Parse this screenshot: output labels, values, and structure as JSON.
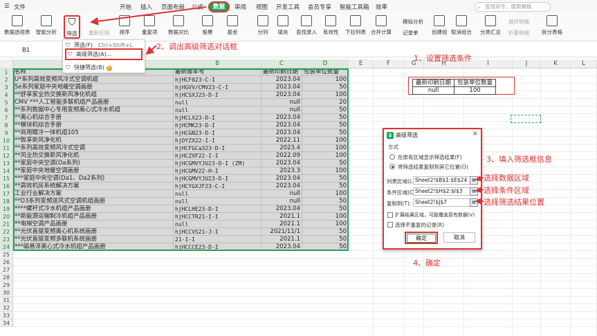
{
  "menubar": {
    "file": "文件",
    "start": "开始",
    "insert": "插入",
    "page_layout": "页面布局",
    "formulas": "公式",
    "data": "数据",
    "review": "审阅",
    "view": "视图",
    "developer": "开发工具",
    "member": "会员专享",
    "smart_toolbox": "智能工具箱",
    "efficiency": "效率",
    "search_placeholder": "查找命令、搜索模板"
  },
  "ribbon": {
    "pivot_table": "数据透视表",
    "smart_analysis": "智能分析",
    "filter": "筛选",
    "reapply": "重新应用",
    "sort": "排序",
    "duplicates": "重复项",
    "compare": "数据对比",
    "stocks": "股票",
    "fund": "基金",
    "split_columns": "分列",
    "fill": "填充",
    "find_entry": "查找录入",
    "validity": "有效性",
    "dropdown_list": "下拉列表",
    "merge_calc": "合并计算",
    "simulation": "模拟分析",
    "record_sheet": "记录单",
    "create_group": "创建组",
    "ungroup": "取消组合",
    "subtotal": "分类汇总",
    "expand_detail": "展开明细",
    "collapse_detail": "折叠明细",
    "split_sheet": "拆分表格"
  },
  "dropdown": {
    "filter": "筛选(F)",
    "filter_shortcut": "Ctrl+Shift+L",
    "advanced_filter": "高级筛选(A)...",
    "quick_filter": "快捷筛选(B)"
  },
  "formula_bar": {
    "cell_ref": "B1",
    "fx": "fx"
  },
  "columns": [
    "A",
    "B",
    "C",
    "D",
    "E",
    "F",
    "G",
    "H",
    "I",
    "J",
    "K",
    "L"
  ],
  "rows": [
    "1",
    "2",
    "3",
    "4",
    "5",
    "6",
    "7",
    "8",
    "9",
    "10",
    "11",
    "12",
    "13",
    "14",
    "15",
    "16",
    "17",
    "18",
    "19",
    "20",
    "21",
    "22",
    "23",
    "24",
    "25",
    "26",
    "27",
    "28",
    "29",
    "30",
    "31",
    "32",
    "33",
    "34"
  ],
  "table": {
    "headers": [
      "名称",
      "最新版本号",
      "最新印刷日期",
      "包装单位数量"
    ],
    "rows": [
      [
        "U*系列高效变频风冷式空调机组",
        "hjHCF023-C-I",
        "2023.04",
        "100"
      ],
      [
        "5e系列家庭中央地暖空调画册",
        "hjHGVV/CMV23-C-I",
        "2023.04",
        "50"
      ],
      [
        "**舒享家全热交换新风净化机组",
        "hjHCSXJ23-D-I",
        "2023.04",
        "100"
      ],
      [
        "CMV ***人工智能多联机组产品画册",
        "null",
        "null",
        "20"
      ],
      [
        "**系列数据中心专用变频离心式冷水机组",
        "null",
        "null",
        "50"
      ],
      [
        "**离心机综合手册",
        "hjHCLX23-D-I",
        "2023.04",
        "50"
      ],
      [
        "**模块机综合手册",
        "hjHCMK23-D-I",
        "2023.04",
        "50"
      ],
      [
        "**商用睛冷一体机组105",
        "hjHCGN23-D-I",
        "2023.04",
        "50"
      ],
      [
        "**致享新风净化机",
        "hjDYZX22-I-I",
        "2022.11",
        "100"
      ],
      [
        "**系列高效变频风冷式空调",
        "hjHCFGCa323-D-I",
        "2023.4",
        "100"
      ],
      [
        "**风全热交换新风净化机",
        "hjHCZXF22-I-I",
        "2022.09",
        "100"
      ],
      [
        "**家庭中央空调(Da系列)",
        "hjHCGMVYJU23-D-I (ZM)",
        "2023.04",
        "50"
      ],
      [
        "**家庭中央地暖空调画册",
        "hjHCGMV22-H-I",
        "2023.3",
        "100"
      ],
      [
        "***家庭中央空调(Da1、Da2系列)",
        "hjHCGMVYJU23-D-I",
        "2023.04",
        "50"
      ],
      [
        "**高效机房系统解决方案",
        "hjHCYGXJF23-C-I",
        "2023.04",
        "50"
      ],
      [
        "工业行业解决方案",
        "null",
        "null",
        "100"
      ],
      [
        "**D3系列变频送风式空调机组画册",
        "null",
        "null",
        "50"
      ],
      [
        "****螺杆式冷水机组产品画册",
        "hjHCLHE23-D-I",
        "2023.04",
        "50"
      ],
      [
        "**新能源运输制冷机组产品画册",
        "hjHCCTR21-I-I",
        "2021.1",
        "100"
      ],
      [
        "**电梯空调产品画册",
        "null",
        "2021.1",
        "100"
      ],
      [
        "**光伏直驱变频离心机系统画册",
        "hjHCCVS21-J-I",
        "2021/11/1",
        "50"
      ],
      [
        "**光伏直驱变频多联机系统画册",
        "21-I-I",
        "2021.1",
        "50"
      ],
      [
        "***磁悬浮离心式冷水机组产品画册",
        "hjHCCCE23-D-I",
        "2023.04",
        "50"
      ]
    ]
  },
  "criteria": {
    "headers": [
      "最新印刷日期",
      "包装单位数量"
    ],
    "values": [
      "null",
      "100"
    ]
  },
  "dialog": {
    "title": "高级筛选",
    "close": "×",
    "method_label": "方式",
    "option1": "在原有区域显示筛选结果(F)",
    "option2": "将筛选结果复制到其它位置(O)",
    "list_range_label": "列表区域(L):",
    "list_range_value": "Sheet2!$B$1:$E$24",
    "criteria_range_label": "条件区域(C):",
    "criteria_range_value": "Sheet2!$H$2:$I$3",
    "copy_to_label": "复制到(T):",
    "copy_to_value": "Sheet2!$J$7",
    "expand_option": "扩展结果区域，可能覆盖原有数据(V)",
    "unique_option": "选择不重复的记录(R)",
    "ok": "确定",
    "cancel": "取消"
  },
  "annotations": {
    "step1": "1、设置筛选条件",
    "step2": "2、调出高级筛选对话框",
    "step3": "3、填入筛选框信息",
    "step4": "4、确定",
    "select_data": "选择数据区域",
    "select_criteria": "选择条件区域",
    "select_result": "选择筛选结果位置"
  },
  "colors": {
    "accent_green": "#1aa55a",
    "annotation_red": "#e03030"
  }
}
